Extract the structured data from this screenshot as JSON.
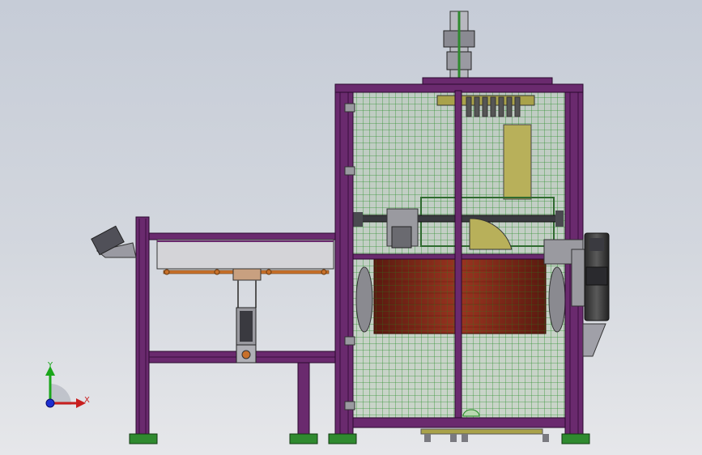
{
  "viewport": {
    "background_top": "#c6ccd7",
    "background_bottom": "#e6e7ea"
  },
  "colors": {
    "frame_purple": "#6a2a6e",
    "frame_purple_dark": "#3a0f3e",
    "mesh_green": "#1f8a1f",
    "drum_red": "#8b2a18",
    "component_olive": "#a9a24a",
    "roller_orange": "#c8702a",
    "foot_green": "#2f8a2f"
  },
  "triad": {
    "y_label": "Y",
    "x_label": "X",
    "y_color": "#1aa61a",
    "x_color": "#c81e1e",
    "z_color": "#1c2fd1"
  }
}
